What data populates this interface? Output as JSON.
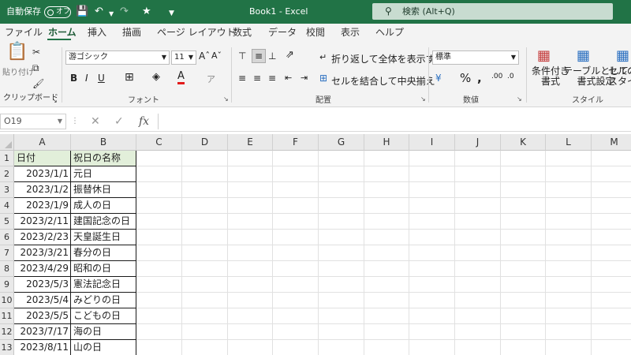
{
  "titlebar": {
    "autosave_label": "自動保存",
    "autosave_state": "オフ",
    "document_title": "Book1  -  Excel",
    "search_placeholder": "検索 (Alt+Q)"
  },
  "menu_tabs": [
    "ファイル",
    "ホーム",
    "挿入",
    "描画",
    "ページ レイアウト",
    "数式",
    "データ",
    "校閲",
    "表示",
    "ヘルプ"
  ],
  "active_tab": "ホーム",
  "ribbon": {
    "clipboard": {
      "paste_label": "貼り付け",
      "group_label": "クリップボード"
    },
    "font": {
      "font_name": "游ゴシック",
      "font_size": "11",
      "group_label": "フォント"
    },
    "alignment": {
      "wrap_text_label": "折り返して全体を表示する",
      "merge_center_label": "セルを結合して中央揃え",
      "group_label": "配置"
    },
    "number": {
      "format": "標準",
      "group_label": "数値"
    },
    "styles": {
      "conditional_format_label": "条件付き\n書式",
      "format_as_table_label": "テーブルとして\n書式設定",
      "cell_styles_label": "セルの\nスタイル",
      "group_label": "スタイル"
    }
  },
  "formula_bar": {
    "name_box": "O19",
    "formula": ""
  },
  "grid": {
    "columns": [
      "A",
      "B",
      "C",
      "D",
      "E",
      "F",
      "G",
      "H",
      "I",
      "J",
      "K",
      "L",
      "M"
    ],
    "rows": [
      "1",
      "2",
      "3",
      "4",
      "5",
      "6",
      "7",
      "8",
      "9",
      "10",
      "11",
      "12",
      "13"
    ],
    "header": [
      "日付",
      "祝日の名称"
    ],
    "data": [
      [
        "2023/1/1",
        "元日"
      ],
      [
        "2023/1/2",
        "振替休日"
      ],
      [
        "2023/1/9",
        "成人の日"
      ],
      [
        "2023/2/11",
        "建国記念の日"
      ],
      [
        "2023/2/23",
        "天皇誕生日"
      ],
      [
        "2023/3/21",
        "春分の日"
      ],
      [
        "2023/4/29",
        "昭和の日"
      ],
      [
        "2023/5/3",
        "憲法記念日"
      ],
      [
        "2023/5/4",
        "みどりの日"
      ],
      [
        "2023/5/5",
        "こどもの日"
      ],
      [
        "2023/7/17",
        "海の日"
      ],
      [
        "2023/8/11",
        "山の日"
      ]
    ]
  },
  "colors": {
    "accent": "#217346",
    "header_fill": "#e2efda"
  }
}
